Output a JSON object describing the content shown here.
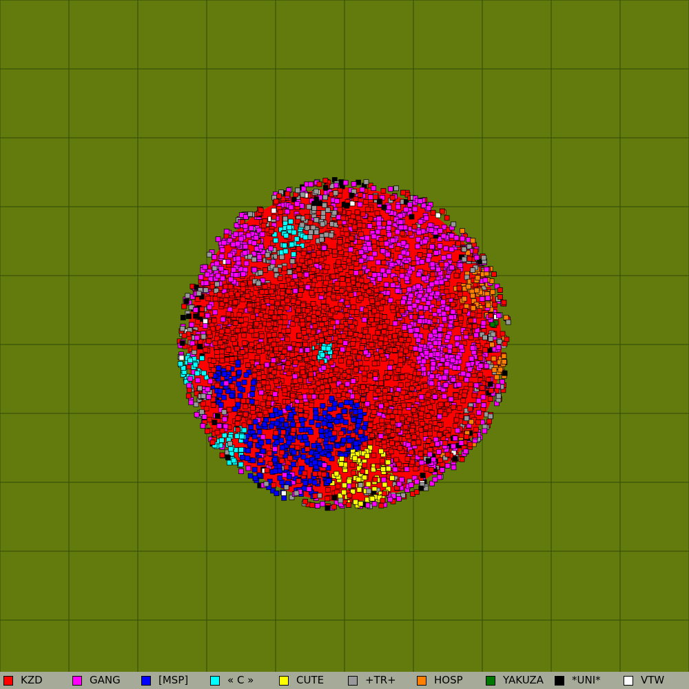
{
  "map": {
    "background": "#637a0c",
    "grid_color": "#2f4a07",
    "description_colors": {
      "border": "#000000"
    }
  },
  "legend": {
    "items": [
      {
        "label": "KZD",
        "color": "#ff0000"
      },
      {
        "label": "GANG",
        "color": "#ff00ff"
      },
      {
        "label": "[MSP]",
        "color": "#0000ff"
      },
      {
        "label": "« C »",
        "color": "#00ffff"
      },
      {
        "label": "CUTE",
        "color": "#ffff00"
      },
      {
        "label": "+TR+",
        "color": "#999999"
      },
      {
        "label": "HOSP",
        "color": "#ff8000"
      },
      {
        "label": "YAKUZA",
        "color": "#007700"
      },
      {
        "label": "*UNI*",
        "color": "#000000"
      },
      {
        "label": "VTW",
        "color": "#ffffff"
      }
    ]
  }
}
